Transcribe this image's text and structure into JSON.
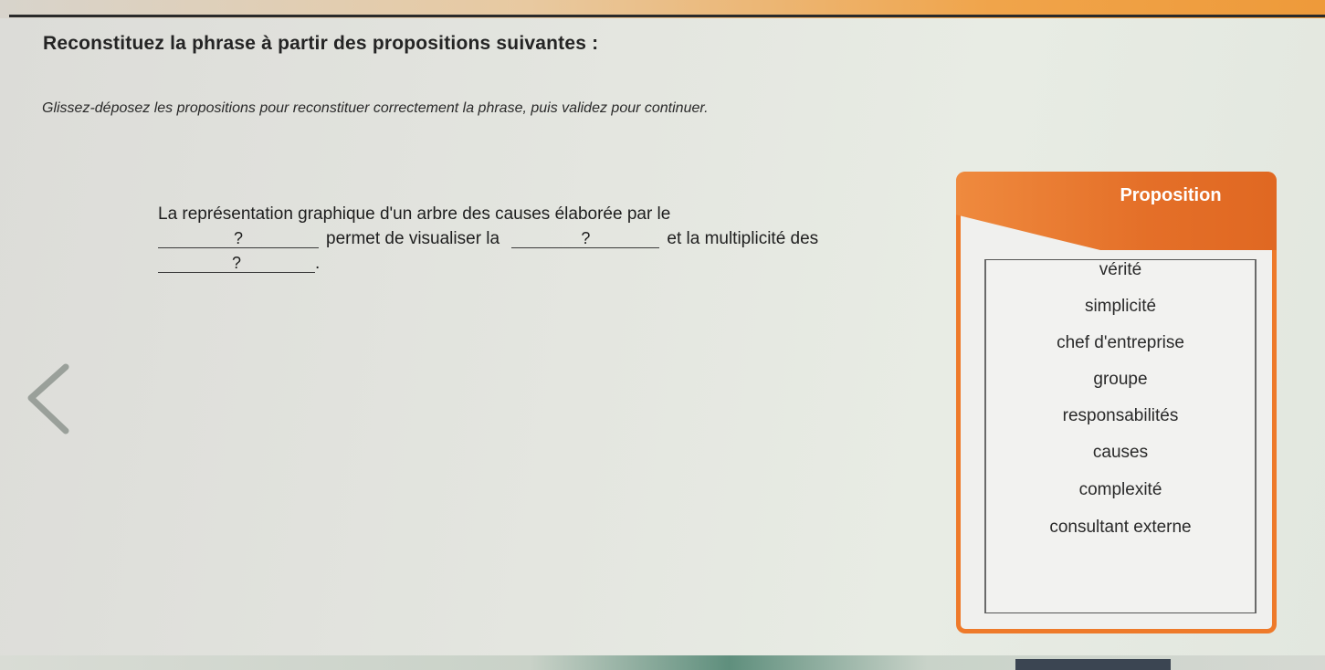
{
  "header": {
    "title": "Reconstituez la phrase à partir des propositions suivantes :",
    "instructions": "Glissez-déposez les propositions pour reconstituer correctement la phrase, puis validez pour continuer."
  },
  "sentence": {
    "part1": "La représentation graphique d'un arbre des causes élaborée par le",
    "blank1": "?",
    "part2": "permet de visualiser la",
    "blank2": "?",
    "part3": "et la multiplicité des",
    "blank3": "?",
    "part4": "."
  },
  "proposition_panel": {
    "title": "Proposition",
    "items": [
      "vérité",
      "simplicité",
      "chef d'entreprise",
      "groupe",
      "responsabilités",
      "causes",
      "complexité",
      "consultant externe"
    ]
  },
  "colors": {
    "accent": "#e4702a",
    "panel_background": "#f0f0ee"
  },
  "icons": {
    "back": "chevron-left-icon"
  }
}
